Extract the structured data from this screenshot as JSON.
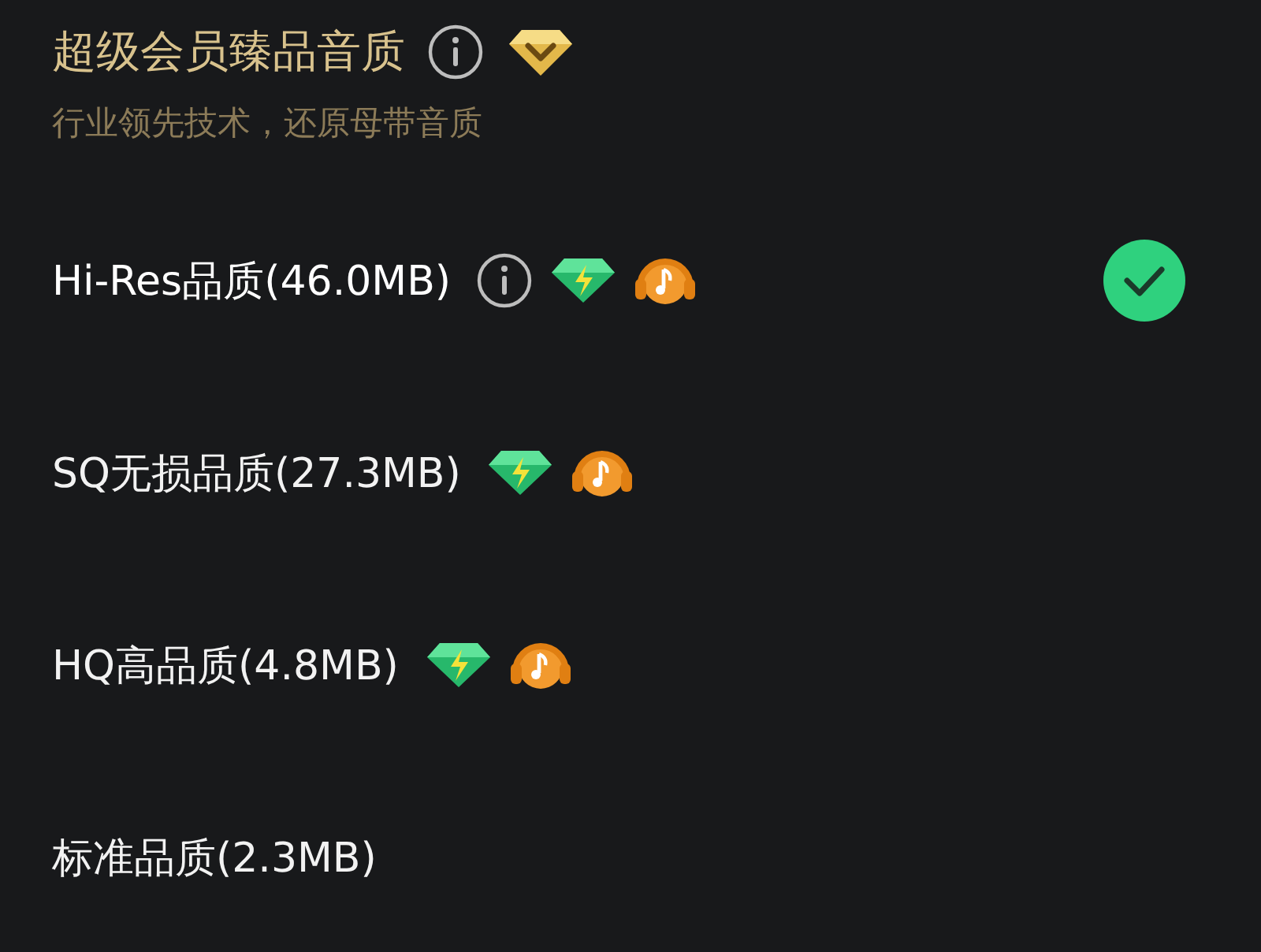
{
  "header": {
    "title": "超级会员臻品音质",
    "subtitle": "行业领先技术，还原母带音质",
    "icons": [
      {
        "kind": "info"
      },
      {
        "kind": "crown"
      }
    ]
  },
  "options": [
    {
      "label": "Hi-Res品质(46.0MB)",
      "icons": [
        {
          "kind": "info"
        },
        {
          "kind": "diamond"
        },
        {
          "kind": "headphones"
        }
      ],
      "selected": true
    },
    {
      "label": "SQ无损品质(27.3MB)",
      "icons": [
        {
          "kind": "diamond"
        },
        {
          "kind": "headphones"
        }
      ],
      "selected": false
    },
    {
      "label": "HQ高品质(4.8MB)",
      "icons": [
        {
          "kind": "diamond"
        },
        {
          "kind": "headphones"
        }
      ],
      "selected": false
    },
    {
      "label": "标准品质(2.3MB)",
      "selected": false
    }
  ]
}
